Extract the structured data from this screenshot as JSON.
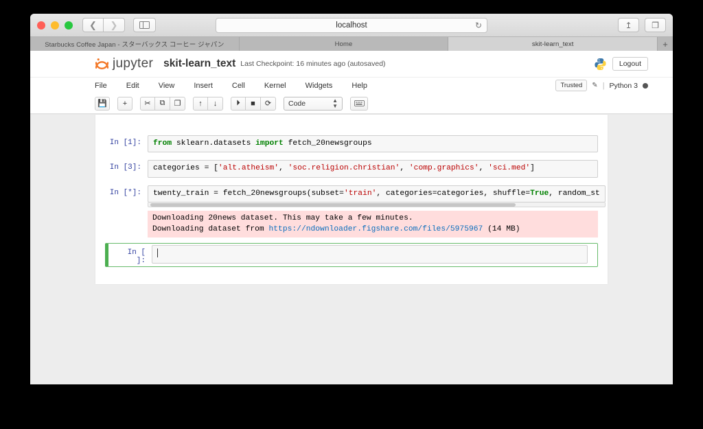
{
  "browser": {
    "address": {
      "url": "localhost",
      "reload_icon": "reload-icon"
    },
    "nav": {
      "back_icon": "chevron-left-icon",
      "forward_icon": "chevron-right-icon",
      "sidebar_icon": "sidebar-toggle-icon"
    },
    "actions": {
      "share_icon": "share-icon",
      "tabs_icon": "show-all-tabs-icon"
    },
    "tabs": [
      {
        "title": "Starbucks Coffee Japan - スターバックス コーヒー ジャパン",
        "active": false
      },
      {
        "title": "Home",
        "active": false
      },
      {
        "title": "skit-learn_text",
        "active": true
      }
    ],
    "new_tab_label": "+"
  },
  "jupyter": {
    "logo_text": "jupyter",
    "notebook_name": "skit-learn_text",
    "checkpoint": "Last Checkpoint: 16 minutes ago (autosaved)",
    "logout_label": "Logout",
    "menu": [
      "File",
      "Edit",
      "View",
      "Insert",
      "Cell",
      "Kernel",
      "Widgets",
      "Help"
    ],
    "trusted_label": "Trusted",
    "kernel_name": "Python 3",
    "toolbar": {
      "cell_type": "Code",
      "buttons": [
        {
          "name": "save-button",
          "glyph": "💾"
        },
        {
          "name": "insert-cell-below-button",
          "glyph": "+"
        },
        {
          "name": "cut-cell-button",
          "glyph": "✂"
        },
        {
          "name": "copy-cell-button",
          "glyph": "⧉"
        },
        {
          "name": "paste-cell-button",
          "glyph": "❐"
        },
        {
          "name": "move-cell-up-button",
          "glyph": "↑"
        },
        {
          "name": "move-cell-down-button",
          "glyph": "↓"
        },
        {
          "name": "run-cell-button",
          "glyph": "⏵"
        },
        {
          "name": "interrupt-kernel-button",
          "glyph": "■"
        },
        {
          "name": "restart-kernel-button",
          "glyph": "⟳"
        }
      ],
      "keyboard_glyph": "⌨"
    },
    "colors": {
      "accent_orange": "#f37726",
      "selected_cell_green": "#4caf50",
      "prompt_blue": "#303f9f",
      "keyword_green": "#008000",
      "string_red": "#bb0000",
      "error_bg": "#ffdddd",
      "link_blue": "#0a6ebd"
    }
  },
  "cells": [
    {
      "prompt": "In [1]:",
      "source_plain": "from sklearn.datasets import fetch_20newsgroups",
      "tokens": [
        {
          "t": "from",
          "c": "kw"
        },
        {
          "t": " sklearn.datasets ",
          "c": ""
        },
        {
          "t": "import",
          "c": "kw"
        },
        {
          "t": " fetch_20newsgroups",
          "c": ""
        }
      ],
      "scrollbar": false,
      "selected": false
    },
    {
      "prompt": "In [3]:",
      "source_plain": "categories = ['alt.atheism', 'soc.religion.christian', 'comp.graphics', 'sci.med']",
      "tokens": [
        {
          "t": "categories = [",
          "c": ""
        },
        {
          "t": "'alt.atheism'",
          "c": "str"
        },
        {
          "t": ", ",
          "c": ""
        },
        {
          "t": "'soc.religion.christian'",
          "c": "str"
        },
        {
          "t": ", ",
          "c": ""
        },
        {
          "t": "'comp.graphics'",
          "c": "str"
        },
        {
          "t": ", ",
          "c": ""
        },
        {
          "t": "'sci.med'",
          "c": "str"
        },
        {
          "t": "]",
          "c": ""
        }
      ],
      "scrollbar": false,
      "selected": false
    },
    {
      "prompt": "In [*]:",
      "source_plain": "twenty_train = fetch_20newsgroups(subset='train', categories=categories, shuffle=True, random_st",
      "tokens": [
        {
          "t": "twenty_train = fetch_20newsgroups(subset=",
          "c": ""
        },
        {
          "t": "'train'",
          "c": "str"
        },
        {
          "t": ", categories=categories, shuffle=",
          "c": ""
        },
        {
          "t": "True",
          "c": "kw"
        },
        {
          "t": ", random_st",
          "c": ""
        }
      ],
      "scrollbar": true,
      "selected": false
    },
    {
      "prompt": "In [ ]:",
      "source_plain": "",
      "tokens": [],
      "scrollbar": false,
      "selected": true
    }
  ],
  "output": {
    "line1": "Downloading 20news dataset. This may take a few minutes.",
    "line2_prefix": "Downloading dataset from ",
    "link": "https://ndownloader.figshare.com/files/5975967",
    "line2_suffix": " (14 MB)"
  }
}
